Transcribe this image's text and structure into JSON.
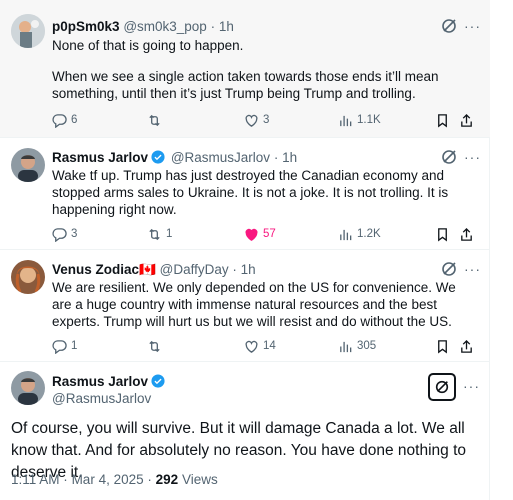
{
  "colors": {
    "verified": "#1d9bf0",
    "like_active": "#f91880",
    "secondary": "#536471",
    "highlight_bg": "#f7f7f7"
  },
  "replies": [
    {
      "name": "p0pSm0k3",
      "handle": "@sm0k3_pop",
      "dot": "·",
      "time": "1h",
      "verified": false,
      "paragraphs": [
        "None of that is going to happen.",
        "When we see a single action taken towards those ends it’ll mean something, until then it’s just Trump being Trump and trolling."
      ],
      "replies": "6",
      "reposts": "",
      "likes": "3",
      "views": "1.1K",
      "liked": false
    },
    {
      "name": "Rasmus Jarlov",
      "handle": "@RasmusJarlov",
      "dot": "·",
      "time": "1h",
      "verified": true,
      "paragraphs": [
        "Wake tf up. Trump has just destroyed the Canadian economy and stopped arms sales to Ukraine. It is not a joke. It is not trolling. It is happening right now."
      ],
      "replies": "3",
      "reposts": "1",
      "likes": "57",
      "views": "1.2K",
      "liked": true
    },
    {
      "name": "Venus Zodiac",
      "flag": "🇨🇦",
      "handle": "@DaffyDay",
      "dot": "·",
      "time": "1h",
      "verified": false,
      "paragraphs": [
        "We are resilient. We only depended on the US for convenience. We are a huge country with immense natural resources and the best experts. Trump will hurt us but we will resist and do without the US."
      ],
      "replies": "1",
      "reposts": "",
      "likes": "14",
      "views": "305",
      "liked": false
    }
  ],
  "main": {
    "name": "Rasmus Jarlov",
    "handle": "@RasmusJarlov",
    "text": "Of course, you will survive. But it will damage Canada a lot. We all know that. And for absolutely no reason. You have done nothing to deserve it.",
    "time": "1:11 AM",
    "dot1": "·",
    "date": "Mar 4, 2025",
    "dot2": "·",
    "views_count": "292",
    "views_label": "Views"
  },
  "icons": {
    "reply": "reply-icon",
    "repost": "repost-icon",
    "like": "heart-icon",
    "views": "views-icon",
    "bookmark": "bookmark-icon",
    "share": "share-icon",
    "grok": "grok-icon",
    "more": "more-icon",
    "verified": "verified-badge-icon"
  }
}
